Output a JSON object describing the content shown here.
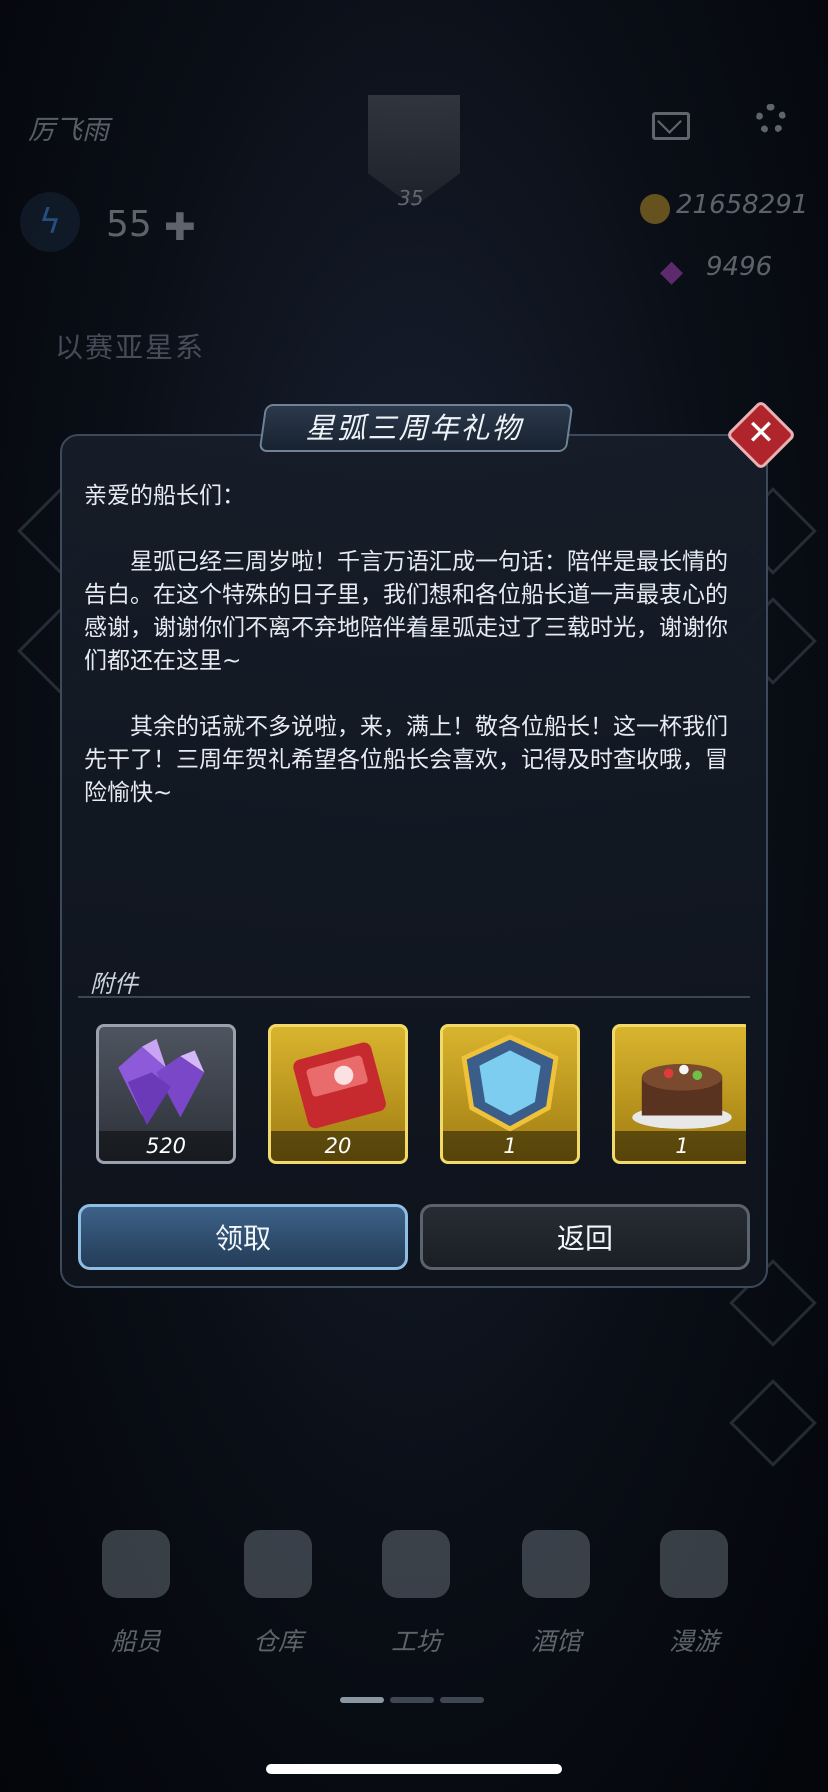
{
  "hud": {
    "player_name": "厉飞雨",
    "avatar_level": "35",
    "energy": "55",
    "coins": "21658291",
    "gems": "9496",
    "system_name": "以赛亚星系"
  },
  "dialog": {
    "title": "星弧三周年礼物",
    "greeting": "亲爱的船长们：",
    "paragraph1": "星弧已经三周岁啦！千言万语汇成一句话：陪伴是最长情的告白。在这个特殊的日子里，我们想和各位船长道一声最衷心的感谢，谢谢你们不离不弃地陪伴着星弧走过了三载时光，谢谢你们都还在这里~",
    "paragraph2": "其余的话就不多说啦，来，满上！敬各位船长！这一杯我们先干了！三周年贺礼希望各位船长会喜欢，记得及时查收哦，冒险愉快~",
    "attachments_label": "附件",
    "items": [
      {
        "icon": "crystal-icon",
        "count": "520"
      },
      {
        "icon": "ticket-icon",
        "count": "20"
      },
      {
        "icon": "shield-badge-icon",
        "count": "1"
      },
      {
        "icon": "cake-icon",
        "count": "1"
      }
    ],
    "claim_label": "领取",
    "back_label": "返回"
  },
  "bottom_nav": [
    {
      "label": "船员",
      "icon": "crew-icon"
    },
    {
      "label": "仓库",
      "icon": "warehouse-icon"
    },
    {
      "label": "工坊",
      "icon": "workshop-icon"
    },
    {
      "label": "酒馆",
      "icon": "tavern-icon"
    },
    {
      "label": "漫游",
      "icon": "roam-icon"
    }
  ],
  "colors": {
    "close_red": "#b0252c",
    "claim_blue": "#3d6288",
    "item_gold": "#d9b42e"
  }
}
